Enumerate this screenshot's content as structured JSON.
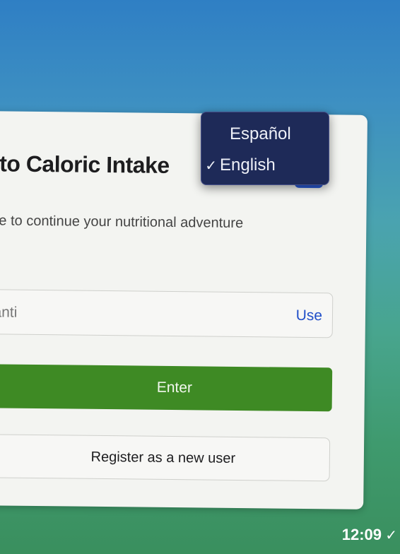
{
  "card": {
    "title": "to Caloric Intake",
    "lang_toggle_icon": "✓",
    "subtitle": "e to continue your nutritional adventure",
    "username": {
      "value": "santi",
      "action_label": "Use"
    },
    "enter_label": "Enter",
    "register_label": "Register as a new user"
  },
  "language_menu": {
    "items": [
      {
        "label": "Español",
        "selected": false,
        "check": ""
      },
      {
        "label": "English",
        "selected": true,
        "check": "✓"
      }
    ]
  },
  "status": {
    "time": "12:09",
    "check": "✓"
  },
  "colors": {
    "accent_green": "#3e8a24",
    "link_blue": "#2250c9",
    "menu_bg": "#1e2a58",
    "toggle_blue": "#2a5bd7"
  }
}
